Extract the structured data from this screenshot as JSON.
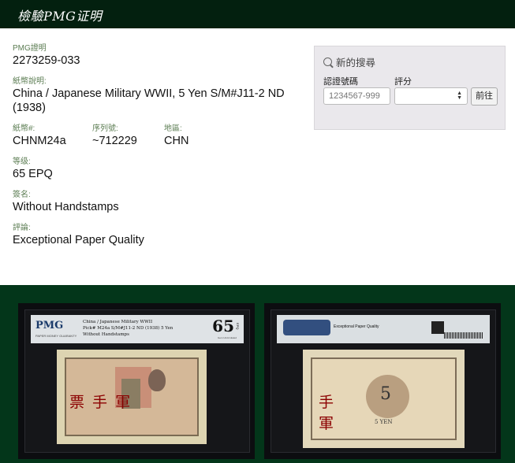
{
  "header": {
    "title": "檢驗PMG证明"
  },
  "cert": {
    "pmg_label": "PMG證明",
    "pmg_value": "2273259-033",
    "desc_label": "紙幣說明:",
    "desc_value": "China / Japanese Military WWII, 5 Yen S/M#J11-2 ND (1938)",
    "note_label": "紙幣#:",
    "note_value": "CHNM24a",
    "serial_label": "序列號:",
    "serial_value": "~712229",
    "region_label": "地區:",
    "region_value": "CHN",
    "grade_label": "等级:",
    "grade_value": "65 EPQ",
    "sign_label": "簽名:",
    "sign_value": "Without Handstamps",
    "comment_label": "評論:",
    "comment_value": "Exceptional Paper Quality"
  },
  "search": {
    "title": "新的搜尋",
    "cert_label": "認證號碼",
    "cert_placeholder": "1234567-999",
    "grade_label": "評分",
    "button": "前往"
  },
  "slab_front": {
    "brand": "PMG",
    "brand_sub": "PAPER MONEY GUARANTY",
    "line1": "China / Japanese Military WWII",
    "line2": "Pick# M24a  S/M#J11-2  ND (1938)  5 Yen",
    "line3": "Without Handstamps",
    "grade": "65",
    "grade_suffix": "EPQ",
    "grade_sub": "Gem Uncirculated",
    "note_red_text": "票 手 軍"
  },
  "slab_back": {
    "comment": "Exceptional Paper Quality",
    "value": "5",
    "yen": "5 YEN",
    "red_text": "手軍"
  }
}
